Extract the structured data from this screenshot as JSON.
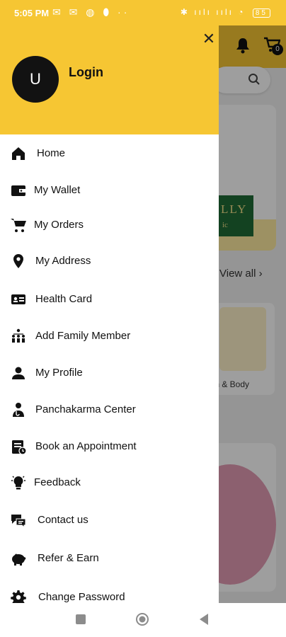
{
  "status_bar": {
    "time": "5:05 PM",
    "left_icons": "✉ ✉ ◍ ⬮ ··",
    "right_icons": "✱ ıılı ıılı ◔",
    "battery": "85"
  },
  "background": {
    "cart_count": "0",
    "banner_text": "LLY",
    "banner_subtext": "ic",
    "view_all": "View all",
    "card_caption": "th & Body"
  },
  "drawer": {
    "avatar_letter": "U",
    "login_label": "Login",
    "close_symbol": "✕",
    "items": [
      {
        "label": "Home",
        "icon": "home-icon"
      },
      {
        "label": "My Wallet",
        "icon": "wallet-icon"
      },
      {
        "label": "My Orders",
        "icon": "cart-icon"
      },
      {
        "label": "My Address",
        "icon": "location-pin-icon"
      },
      {
        "label": "Health Card",
        "icon": "id-card-icon"
      },
      {
        "label": "Add Family Member",
        "icon": "family-tree-icon"
      },
      {
        "label": "My Profile",
        "icon": "person-icon"
      },
      {
        "label": "Panchakarma Center",
        "icon": "doctor-icon"
      },
      {
        "label": "Book an Appointment",
        "icon": "appointment-icon"
      },
      {
        "label": "Feedback",
        "icon": "lightbulb-icon"
      },
      {
        "label": "Contact us",
        "icon": "chat-bubble-icon"
      },
      {
        "label": "Refer & Earn",
        "icon": "piggy-bank-icon"
      },
      {
        "label": "Change Password",
        "icon": "gear-icon"
      }
    ]
  },
  "colors": {
    "accent": "#f6c633",
    "avatar_bg": "#121212",
    "banner_green": "#1f6b36"
  }
}
